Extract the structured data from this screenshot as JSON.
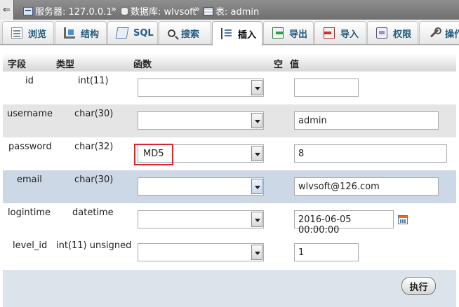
{
  "breadcrumb": {
    "back_glyph": "⇐",
    "server": "服务器: 127.0.0.1",
    "database": "数据库: wlvsoft",
    "table": "表: admin",
    "separator": "»"
  },
  "tabs": [
    {
      "label": "浏览",
      "icon": "browse-icon"
    },
    {
      "label": "结构",
      "icon": "structure-icon"
    },
    {
      "label": "SQL",
      "icon": "sql-icon"
    },
    {
      "label": "搜索",
      "icon": "search-icon"
    },
    {
      "label": "插入",
      "icon": "insert-icon",
      "active": true
    },
    {
      "label": "导出",
      "icon": "export-icon"
    },
    {
      "label": "导入",
      "icon": "import-icon"
    },
    {
      "label": "权限",
      "icon": "privileges-icon"
    },
    {
      "label": "操作",
      "icon": "operations-icon"
    }
  ],
  "table_header": {
    "field": "字段",
    "type": "类型",
    "function": "函数",
    "null": "空",
    "value": "值"
  },
  "rows": [
    {
      "field": "id",
      "type": "int(11)",
      "function": "",
      "value": ""
    },
    {
      "field": "username",
      "type": "char(30)",
      "function": "",
      "value": "admin"
    },
    {
      "field": "password",
      "type": "char(32)",
      "function": "MD5",
      "value": "8"
    },
    {
      "field": "email",
      "type": "char(30)",
      "function": "",
      "value": "wlvsoft@126.com"
    },
    {
      "field": "logintime",
      "type": "datetime",
      "function": "",
      "value": "2016-06-05 00:00:00"
    },
    {
      "field": "level_id",
      "type": "int(11) unsigned",
      "function": "",
      "value": "1"
    }
  ],
  "execute_label": "执行",
  "colors": {
    "highlight_border": "#d9262e",
    "hover_row": "#ccd8e6",
    "tab_text": "#235a81"
  }
}
